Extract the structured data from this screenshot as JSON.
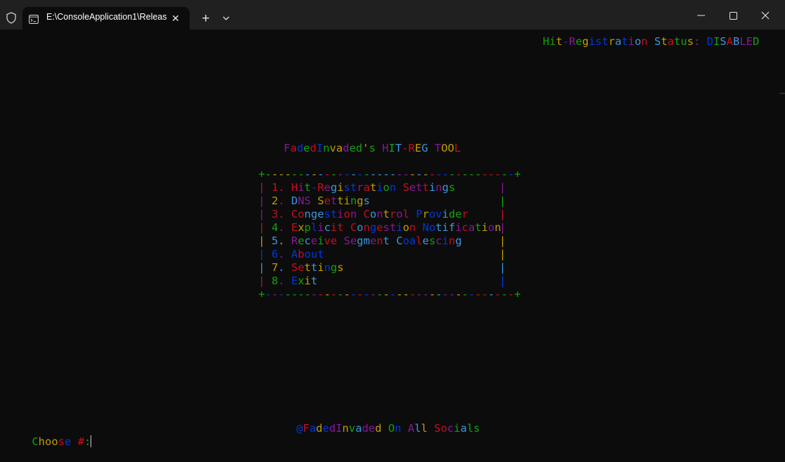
{
  "window": {
    "tab_title": "E:\\ConsoleApplication1\\Releas",
    "icons": [
      "shield-icon",
      "terminal-icon",
      "close-icon",
      "plus-icon",
      "chevron-down-icon",
      "minimize-icon",
      "maximize-icon",
      "close-window-icon"
    ]
  },
  "palette": [
    "#c50f1f",
    "#13a10e",
    "#0037da",
    "#881798",
    "#3a96dd",
    "#c19c00"
  ],
  "console": {
    "status": "Hit-Registration Status: DISABLED",
    "title": "FadedInvaded's HIT-REG TOOL",
    "border_top": "+--------------------------------------+",
    "border_bottom": "+--------------------------------------+",
    "menu": [
      "1. Hit-Registration Settings",
      "2. DNS Settings",
      "3. Congestion Control Provider",
      "4. Explicit Congestion Notification",
      "5. Receive Segment Coalescing",
      "6. About",
      "7. Settings",
      "8. Exit"
    ],
    "prompt": "Choose #:",
    "socials": "@FadedInvaded On All Socials"
  }
}
